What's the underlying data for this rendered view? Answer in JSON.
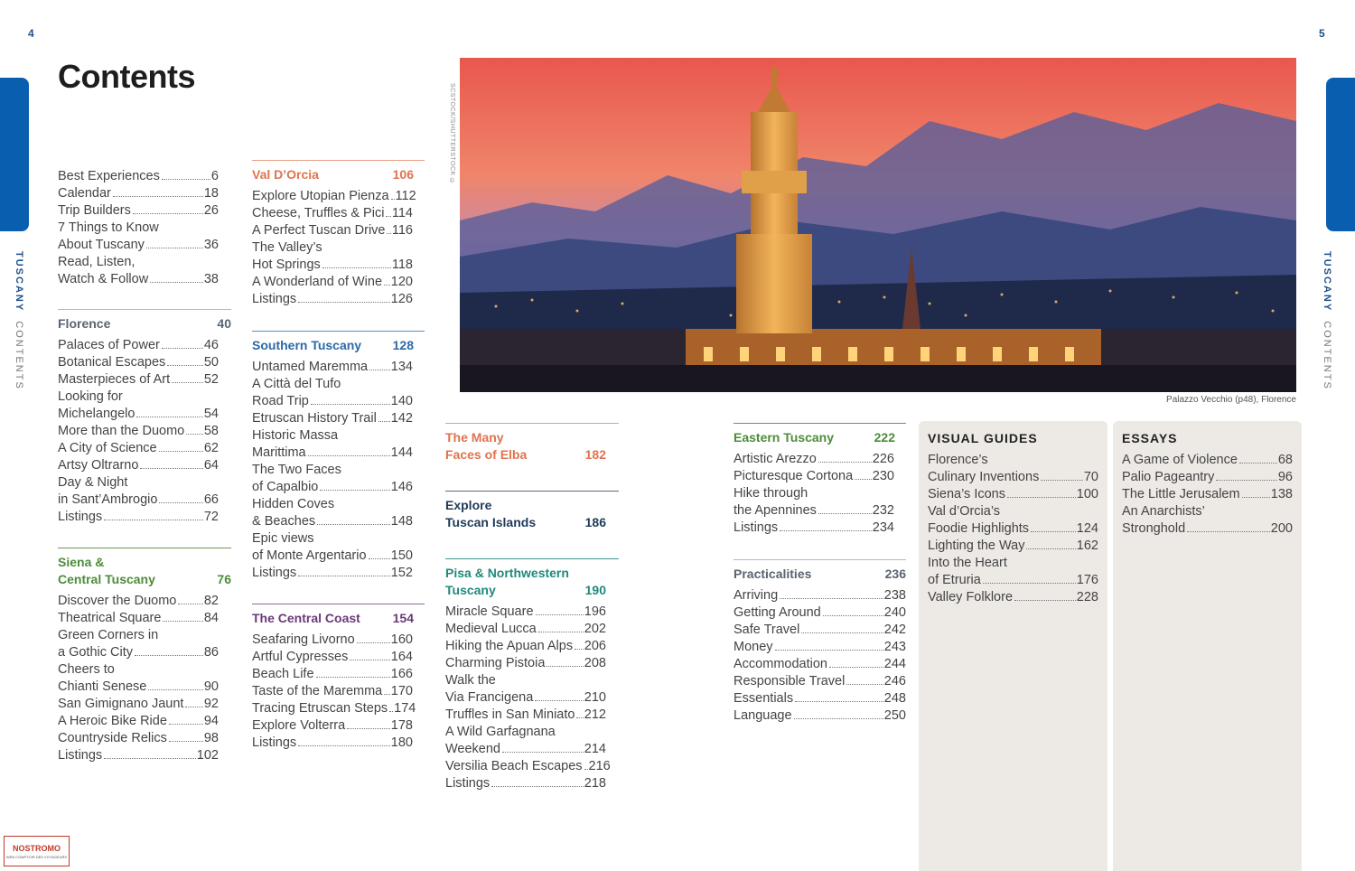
{
  "pages": {
    "left": "4",
    "right": "5"
  },
  "side_label": {
    "book": "TUSCANY",
    "section": "CONTENTS"
  },
  "title": "Contents",
  "photo": {
    "credit": "SCSTOCK/SHUTTERSTOCK ©",
    "caption": "Palazzo Vecchio (p48), Florence"
  },
  "col1": {
    "intro": {
      "entries": [
        {
          "label": "Best Experiences",
          "page": "6"
        },
        {
          "label": "Calendar",
          "page": "18"
        },
        {
          "label": "Trip Builders",
          "page": "26"
        },
        {
          "pre": "7 Things to Know",
          "label": "About Tuscany",
          "page": "36"
        },
        {
          "pre": "Read, Listen,",
          "label": "Watch & Follow",
          "page": "38"
        }
      ]
    },
    "florence": {
      "title": "Florence",
      "page": "40",
      "entries": [
        {
          "label": "Palaces of Power",
          "page": "46"
        },
        {
          "label": "Botanical Escapes",
          "page": "50"
        },
        {
          "label": "Masterpieces of Art",
          "page": "52"
        },
        {
          "pre": "Looking for",
          "label": "Michelangelo",
          "page": "54"
        },
        {
          "label": "More than the Duomo",
          "page": "58"
        },
        {
          "label": "A City of Science",
          "page": "62"
        },
        {
          "label": "Artsy Oltrarno",
          "page": "64"
        },
        {
          "pre": "Day & Night",
          "label": "in Sant’Ambrogio",
          "page": "66"
        },
        {
          "label": "Listings",
          "page": "72"
        }
      ]
    },
    "siena": {
      "title1": "Siena &",
      "title2": "Central Tuscany",
      "page": "76",
      "entries": [
        {
          "label": "Discover the Duomo",
          "page": "82"
        },
        {
          "label": "Theatrical Square",
          "page": "84"
        },
        {
          "pre": "Green Corners in",
          "label": "a Gothic City",
          "page": "86"
        },
        {
          "pre": "Cheers to",
          "label": "Chianti Senese",
          "page": "90"
        },
        {
          "label": "San Gimignano Jaunt",
          "page": "92"
        },
        {
          "label": "A Heroic Bike Ride",
          "page": "94"
        },
        {
          "label": "Countryside Relics",
          "page": "98"
        },
        {
          "label": "Listings",
          "page": "102"
        }
      ]
    }
  },
  "col2": {
    "valdorcia": {
      "title": "Val D’Orcia",
      "page": "106",
      "entries": [
        {
          "label": "Explore Utopian Pienza",
          "page": "112"
        },
        {
          "label": "Cheese, Truffles & Pici",
          "page": "114"
        },
        {
          "label": "A Perfect Tuscan Drive",
          "page": "116"
        },
        {
          "pre": "The Valley’s",
          "label": "Hot Springs",
          "page": "118"
        },
        {
          "label": "A Wonderland of Wine",
          "page": "120"
        },
        {
          "label": "Listings",
          "page": "126"
        }
      ]
    },
    "southern": {
      "title": "Southern Tuscany",
      "page": "128",
      "entries": [
        {
          "label": "Untamed Maremma",
          "page": "134"
        },
        {
          "pre": "A Città del Tufo",
          "label": "Road Trip",
          "page": "140"
        },
        {
          "label": "Etruscan History Trail",
          "page": "142"
        },
        {
          "pre": "Historic Massa",
          "label": "Marittima",
          "page": "144"
        },
        {
          "pre": "The Two Faces",
          "label": "of Capalbio",
          "page": "146"
        },
        {
          "pre": "Hidden Coves",
          "label": "& Beaches",
          "page": "148"
        },
        {
          "pre": "Epic views",
          "label": "of Monte Argentario",
          "page": "150"
        },
        {
          "label": "Listings",
          "page": "152"
        }
      ]
    },
    "central": {
      "title": "The Central Coast",
      "page": "154",
      "entries": [
        {
          "label": "Seafaring Livorno",
          "page": "160"
        },
        {
          "label": "Artful Cypresses",
          "page": "164"
        },
        {
          "label": "Beach Life",
          "page": "166"
        },
        {
          "label": "Taste of the Maremma",
          "page": "170"
        },
        {
          "label": "Tracing Etruscan Steps",
          "page": "174"
        },
        {
          "label": "Explore Volterra",
          "page": "178"
        },
        {
          "label": "Listings",
          "page": "180"
        }
      ]
    }
  },
  "col3": {
    "elba": {
      "title1": "The Many",
      "title2": "Faces of Elba",
      "page": "182"
    },
    "islands": {
      "title1": "Explore",
      "title2": "Tuscan Islands",
      "page": "186"
    },
    "pisa": {
      "title1": "Pisa & Northwestern",
      "title2": "Tuscany",
      "page": "190",
      "entries": [
        {
          "label": "Miracle Square",
          "page": "196"
        },
        {
          "label": "Medieval Lucca",
          "page": "202"
        },
        {
          "label": "Hiking the Apuan Alps",
          "page": "206"
        },
        {
          "label": "Charming Pistoia",
          "page": "208"
        },
        {
          "pre": "Walk the",
          "label": "Via Francigena",
          "page": "210"
        },
        {
          "label": "Truffles in San Miniato",
          "page": "212"
        },
        {
          "pre": "A Wild Garfagnana",
          "label": "Weekend",
          "page": "214"
        },
        {
          "label": "Versilia Beach Escapes",
          "page": "216"
        },
        {
          "label": "Listings",
          "page": "218"
        }
      ]
    }
  },
  "col4": {
    "eastern": {
      "title": "Eastern Tuscany",
      "page": "222",
      "entries": [
        {
          "label": "Artistic Arezzo",
          "page": "226"
        },
        {
          "label": "Picturesque Cortona",
          "page": "230"
        },
        {
          "pre": "Hike through",
          "label": "the Apennines",
          "page": "232"
        },
        {
          "label": "Listings",
          "page": "234"
        }
      ]
    },
    "practicalities": {
      "title": "Practicalities",
      "page": "236",
      "entries": [
        {
          "label": "Arriving",
          "page": "238"
        },
        {
          "label": "Getting Around",
          "page": "240"
        },
        {
          "label": "Safe Travel",
          "page": "242"
        },
        {
          "label": "Money",
          "page": "243"
        },
        {
          "label": "Accommodation",
          "page": "244"
        },
        {
          "label": "Responsible Travel",
          "page": "246"
        },
        {
          "label": "Essentials",
          "page": "248"
        },
        {
          "label": "Language",
          "page": "250"
        }
      ]
    }
  },
  "visual_guides": {
    "title": "VISUAL GUIDES",
    "entries": [
      {
        "pre": "Florence’s",
        "label": "Culinary Inventions",
        "page": "70"
      },
      {
        "label": "Siena’s Icons",
        "page": "100"
      },
      {
        "pre": "Val d’Orcia’s",
        "label": "Foodie Highlights",
        "page": "124"
      },
      {
        "label": "Lighting the Way",
        "page": "162"
      },
      {
        "pre": "Into the Heart",
        "label": "of Etruria",
        "page": "176"
      },
      {
        "label": "Valley Folklore",
        "page": "228"
      }
    ]
  },
  "essays": {
    "title": "ESSAYS",
    "entries": [
      {
        "label": "A Game of Violence",
        "page": "68"
      },
      {
        "label": "Palio Pageantry",
        "page": "96"
      },
      {
        "label": "The Little Jerusalem",
        "page": "138"
      },
      {
        "pre": "An Anarchists’",
        "label": "Stronghold",
        "page": "200"
      }
    ]
  },
  "logo": {
    "name": "NOSTROMO",
    "tagline": "WEB COMPTOIR DES VOYAGEURS"
  },
  "colors": {
    "brand_blue": "#0a5eb0",
    "florence": "#5a6470",
    "siena": "#4c8c3a",
    "valdorcia": "#e0734e",
    "southern": "#2a6aa8",
    "central": "#6a3a7a",
    "islands": "#1e3a5a",
    "pisa": "#1f8a7a",
    "sidebox": "#ede9e5"
  }
}
